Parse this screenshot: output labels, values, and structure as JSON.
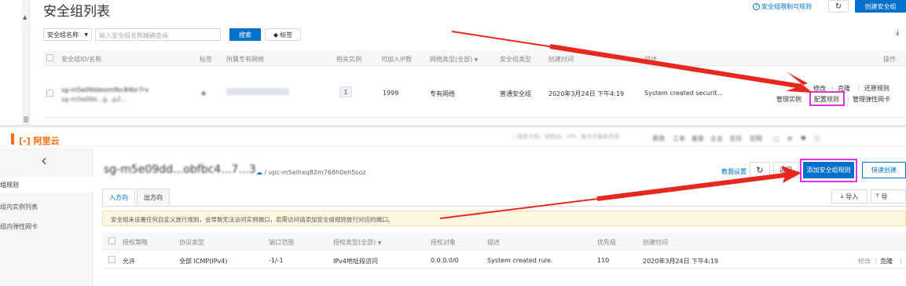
{
  "top": {
    "page_title": "安全组列表",
    "help_link": "安全组限制与规则",
    "refresh_icon": "↻",
    "create_button": "创建安全组",
    "search_select": "安全组名称",
    "search_placeholder": "输入安全组名称精确查询",
    "search_button": "搜索",
    "tag_button": "标签",
    "columns": [
      "安全组ID/名称",
      "标签",
      "所属专有网络",
      "相关实例",
      "可加入IP数",
      "网络类型(全部)",
      "安全组类型",
      "创建时间",
      "描述",
      "操作"
    ],
    "row": {
      "id_line1": "sg-m5e09ddxomfbc84br7rv",
      "id_line2": "sg-m5e09d...g...p2...",
      "related_instances": "1",
      "ip_count": "1999",
      "network_type": "专有网络",
      "group_type": "普通安全组",
      "created": "2020年3月24日 下午4:19",
      "description": "System created securit...",
      "actions_line1": [
        "修改",
        "克隆",
        "还原规则"
      ],
      "actions_line2": [
        "管理实例",
        "配置规则",
        "管理弹性网卡"
      ]
    }
  },
  "bottom": {
    "logo_text": "阿里云",
    "search_hint": "搜索文档、控制台、API、解决方案和资源",
    "nav_items": [
      "费用",
      "工单",
      "备案",
      "企业",
      "支持",
      "官网"
    ],
    "back_icon": "‹",
    "sidebar_items": [
      "组规则",
      "组内实例列表",
      "组内弹性网卡"
    ],
    "sg_title": "sg-m5e09dd...obfbc4...7...3",
    "vpc_path": "/ vpc-m5elhxq82m768h0eh5soz",
    "tutorial_link": "教我设置",
    "refresh_icon": "↻",
    "back_button": "返回",
    "add_rule_button": "添加安全组规则",
    "quick_create_button": "快速创建",
    "tabs": [
      "入方向",
      "出方向"
    ],
    "import_button": "导入",
    "export_button": "导",
    "notice": "安全组未设置任何自定义放行规则，会导致无法访问实例端口，若需访问请添加安全组规则放行对应的端口。",
    "columns": [
      "授权策略",
      "协议类型",
      "端口范围",
      "授权类型(全部)",
      "授权对象",
      "描述",
      "优先级",
      "创建时间"
    ],
    "row": {
      "policy": "允许",
      "protocol": "全部 ICMP(IPv4)",
      "port": "-1/-1",
      "auth_type": "IPv4地址段访问",
      "auth_object": "0.0.0.0/0",
      "description": "System created rule.",
      "priority": "110",
      "created": "2020年3月24日 下午4:19",
      "actions": [
        "修改",
        "克隆"
      ]
    }
  },
  "colors": {
    "primary": "#0070cc",
    "annotation_red": "#e8281e",
    "highlight_magenta": "#e033e0",
    "notice_bg": "#fff7e1",
    "logo_orange": "#ff6a00"
  }
}
